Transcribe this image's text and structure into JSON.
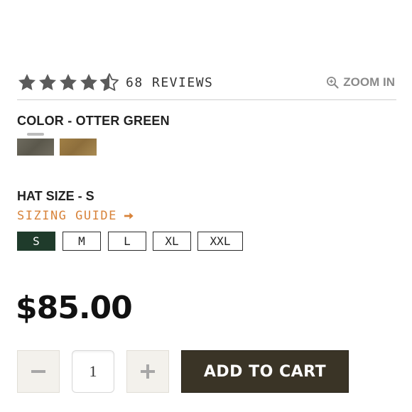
{
  "rating": {
    "stars_value": 4.5,
    "stars_max": 5,
    "reviews_text": "68 REVIEWS",
    "star_color": "#5b5b5b"
  },
  "zoom": {
    "label": "ZOOM IN",
    "icon": "zoom-in-icon",
    "color": "#8a8a8a"
  },
  "color": {
    "label": "COLOR - OTTER GREEN",
    "swatches": [
      {
        "name": "Otter Green",
        "selected": true,
        "color": "#625f53"
      },
      {
        "name": "Tan",
        "selected": false,
        "color": "#9a7a43"
      }
    ]
  },
  "size": {
    "label": "HAT SIZE - S",
    "guide_label": "SIZING GUIDE",
    "guide_icon": "arrow-right-icon",
    "guide_color": "#d8833a",
    "options": [
      "S",
      "M",
      "L",
      "XL",
      "XXL"
    ],
    "selected": "S",
    "selected_color": "#1f3b2b"
  },
  "price": "$85.00",
  "quantity": {
    "value": "1",
    "minus_icon": "minus-icon",
    "plus_icon": "plus-icon"
  },
  "cart": {
    "label": "ADD TO CART",
    "color": "#3a3426"
  }
}
